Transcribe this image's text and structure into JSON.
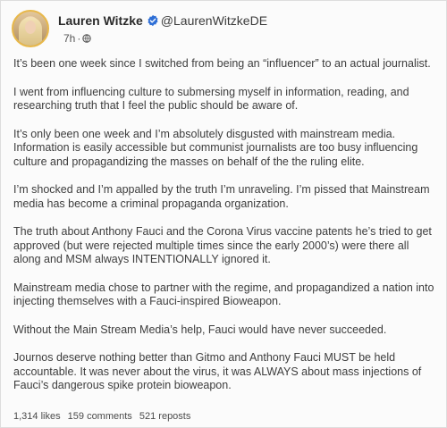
{
  "post": {
    "author_name": "Lauren Witzke",
    "handle": "@LaurenWitzkeDE",
    "time": "7h",
    "separator": "·",
    "paragraphs": [
      "It’s been one week since I switched from being an “influencer” to an actual journalist.",
      "I went from influencing culture to submersing myself in information, reading, and researching truth that I feel the public should be aware of.",
      "It’s only been one week and I’m absolutely disgusted with mainstream media. Information is easily accessible but communist journalists are too busy influencing culture and propagandizing the masses on behalf of the the ruling elite.",
      "I’m shocked and I’m appalled by the truth I’m unraveling. I’m pissed that Mainstream media has become a criminal propaganda organization.",
      "The truth about Anthony Fauci and the Corona Virus vaccine patents he’s tried to get approved (but were rejected multiple times since the early 2000’s) were there all along and MSM always INTENTIONALLY ignored it.",
      "Mainstream media chose to partner with the regime, and propagandized a nation into injecting themselves with a Fauci-inspired Bioweapon.",
      "Without the Main Stream Media’s help, Fauci would have never succeeded.",
      "Journos deserve nothing better than Gitmo and Anthony Fauci MUST be held accountable. It was never about the virus, it was ALWAYS about mass injections of Fauci’s dangerous spike protein bioweapon."
    ],
    "stats": {
      "likes": "1,314 likes",
      "comments": "159 comments",
      "reposts": "521 reposts"
    }
  },
  "icons": {
    "verified": "verified-badge-icon",
    "visibility": "globe-icon"
  },
  "colors": {
    "verified_blue": "#2f6fd6",
    "avatar_ring": "#e8b84a",
    "background": "#fbfbfb"
  }
}
